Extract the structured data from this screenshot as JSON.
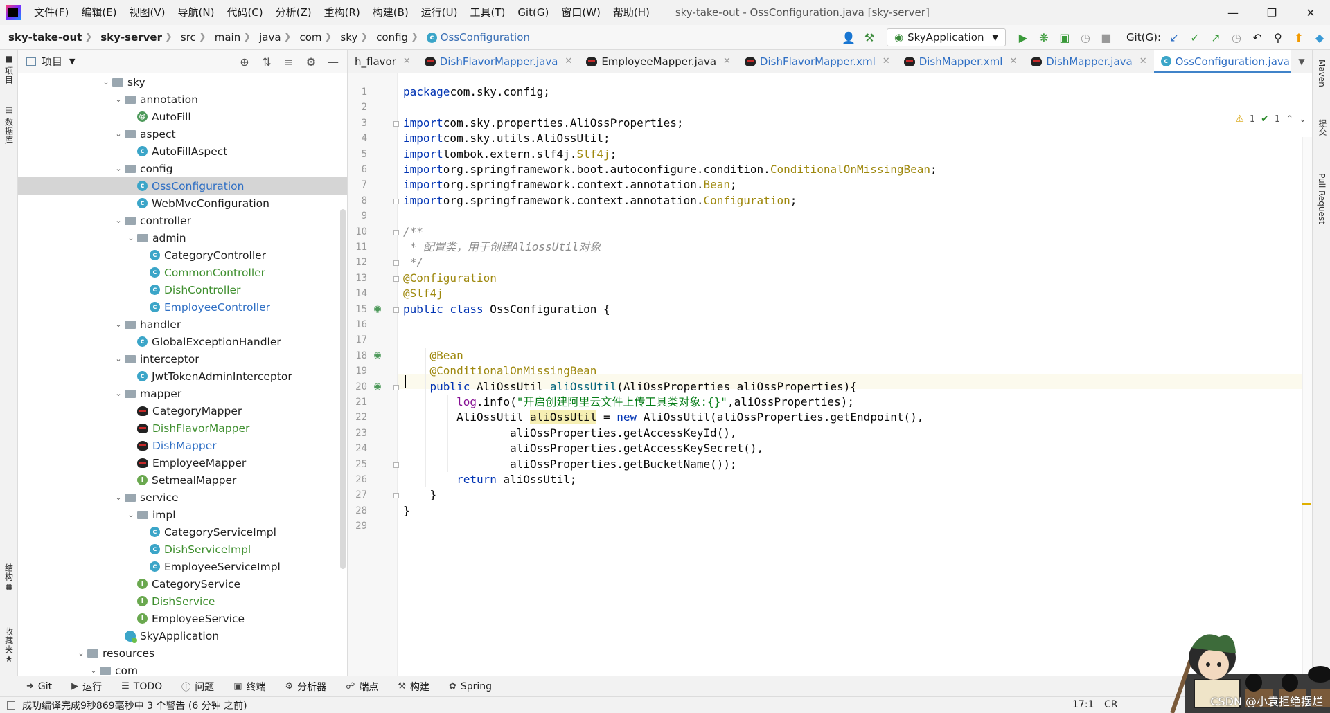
{
  "menu": [
    "文件(F)",
    "编辑(E)",
    "视图(V)",
    "导航(N)",
    "代码(C)",
    "分析(Z)",
    "重构(R)",
    "构建(B)",
    "运行(U)",
    "工具(T)",
    "Git(G)",
    "窗口(W)",
    "帮助(H)"
  ],
  "window_title": "sky-take-out - OssConfiguration.java [sky-server]",
  "breadcrumb": {
    "project": "sky-take-out",
    "module": "sky-server",
    "parts": [
      "src",
      "main",
      "java",
      "com",
      "sky",
      "config"
    ],
    "file": "OssConfiguration"
  },
  "run_config": "SkyApplication",
  "git_label": "Git(G):",
  "left_tabs": {
    "project": "项目",
    "database": "数据库",
    "structure": "结构",
    "favorites": "收藏夹"
  },
  "right_tabs": {
    "maven": "Maven",
    "commit": "提交",
    "pull": "Pull Request"
  },
  "project_panel": {
    "title": "项目"
  },
  "tree": [
    {
      "label": "sky",
      "type": "folder",
      "level": 0,
      "expanded": true
    },
    {
      "label": "annotation",
      "type": "folder",
      "level": 1,
      "expanded": true
    },
    {
      "label": "AutoFill",
      "type": "annotation",
      "level": 2
    },
    {
      "label": "aspect",
      "type": "folder",
      "level": 1,
      "expanded": true
    },
    {
      "label": "AutoFillAspect",
      "type": "class",
      "level": 2
    },
    {
      "label": "config",
      "type": "folder",
      "level": 1,
      "expanded": true
    },
    {
      "label": "OssConfiguration",
      "type": "class",
      "level": 2,
      "selected": true,
      "color": "blue"
    },
    {
      "label": "WebMvcConfiguration",
      "type": "class",
      "level": 2
    },
    {
      "label": "controller",
      "type": "folder",
      "level": 1,
      "expanded": true
    },
    {
      "label": "admin",
      "type": "folder",
      "level": 2,
      "expanded": true
    },
    {
      "label": "CategoryController",
      "type": "class",
      "level": 3
    },
    {
      "label": "CommonController",
      "type": "class",
      "level": 3,
      "color": "green"
    },
    {
      "label": "DishController",
      "type": "class",
      "level": 3,
      "color": "green"
    },
    {
      "label": "EmployeeController",
      "type": "class",
      "level": 3,
      "color": "blue"
    },
    {
      "label": "handler",
      "type": "folder",
      "level": 1,
      "expanded": true
    },
    {
      "label": "GlobalExceptionHandler",
      "type": "class",
      "level": 2
    },
    {
      "label": "interceptor",
      "type": "folder",
      "level": 1,
      "expanded": true
    },
    {
      "label": "JwtTokenAdminInterceptor",
      "type": "class",
      "level": 2
    },
    {
      "label": "mapper",
      "type": "folder",
      "level": 1,
      "expanded": true
    },
    {
      "label": "CategoryMapper",
      "type": "mapper",
      "level": 2
    },
    {
      "label": "DishFlavorMapper",
      "type": "mapper",
      "level": 2,
      "color": "green"
    },
    {
      "label": "DishMapper",
      "type": "mapper",
      "level": 2,
      "color": "blue"
    },
    {
      "label": "EmployeeMapper",
      "type": "mapper",
      "level": 2
    },
    {
      "label": "SetmealMapper",
      "type": "interface",
      "level": 2
    },
    {
      "label": "service",
      "type": "folder",
      "level": 1,
      "expanded": true
    },
    {
      "label": "impl",
      "type": "folder",
      "level": 2,
      "expanded": true
    },
    {
      "label": "CategoryServiceImpl",
      "type": "class",
      "level": 3
    },
    {
      "label": "DishServiceImpl",
      "type": "class",
      "level": 3,
      "color": "green"
    },
    {
      "label": "EmployeeServiceImpl",
      "type": "class",
      "level": 3
    },
    {
      "label": "CategoryService",
      "type": "interface",
      "level": 2
    },
    {
      "label": "DishService",
      "type": "interface",
      "level": 2,
      "color": "green"
    },
    {
      "label": "EmployeeService",
      "type": "interface",
      "level": 2
    },
    {
      "label": "SkyApplication",
      "type": "app",
      "level": 1
    },
    {
      "label": "resources",
      "type": "folder",
      "level": -2,
      "expanded": true
    },
    {
      "label": "com",
      "type": "folder",
      "level": -1,
      "expanded": true
    }
  ],
  "tabs": [
    {
      "label": "h_flavor",
      "kind": "plain",
      "partial": true
    },
    {
      "label": "DishFlavorMapper.java",
      "kind": "mapper"
    },
    {
      "label": "EmployeeMapper.java",
      "kind": "mapper",
      "plain": true
    },
    {
      "label": "DishFlavorMapper.xml",
      "kind": "mapper"
    },
    {
      "label": "DishMapper.xml",
      "kind": "mapper"
    },
    {
      "label": "DishMapper.java",
      "kind": "mapper"
    },
    {
      "label": "OssConfiguration.java",
      "kind": "class",
      "active": true
    }
  ],
  "inspections": {
    "warnings": "1",
    "ok": "1"
  },
  "code_lines": [
    [
      [
        "kw",
        "package"
      ],
      [
        "",
        "com.sky.config;"
      ]
    ],
    [],
    [
      [
        "kw",
        "import"
      ],
      [
        "",
        "com.sky.properties.AliOssProperties;"
      ]
    ],
    [
      [
        "kw",
        "import"
      ],
      [
        "",
        "com.sky.utils.AliOssUtil;"
      ]
    ],
    [
      [
        "kw",
        "import"
      ],
      [
        "",
        "lombok.extern.slf4j."
      ],
      [
        "ann",
        "Slf4j"
      ],
      [
        "",
        ";"
      ]
    ],
    [
      [
        "kw",
        "import"
      ],
      [
        "",
        "org.springframework.boot.autoconfigure.condition."
      ],
      [
        "ann",
        "ConditionalOnMissingBean"
      ],
      [
        "",
        ";"
      ]
    ],
    [
      [
        "kw",
        "import"
      ],
      [
        "",
        "org.springframework.context.annotation."
      ],
      [
        "ann",
        "Bean"
      ],
      [
        "",
        ";"
      ]
    ],
    [
      [
        "kw",
        "import"
      ],
      [
        "",
        "org.springframework.context.annotation."
      ],
      [
        "ann",
        "Configuration"
      ],
      [
        "",
        ";"
      ]
    ],
    [],
    [
      [
        "cmt",
        "/**"
      ]
    ],
    [
      [
        "cmt",
        " * 配置类，用于创建AliossUtil对象"
      ]
    ],
    [
      [
        "cmt",
        " */"
      ]
    ],
    [
      [
        "ann",
        "@Configuration"
      ]
    ],
    [
      [
        "ann",
        "@Slf4j"
      ]
    ],
    [
      [
        "kw",
        "public class "
      ],
      [
        "",
        "OssConfiguration {"
      ]
    ],
    [],
    [],
    [
      [
        "",
        "    "
      ],
      [
        "ann",
        "@Bean"
      ]
    ],
    [
      [
        "",
        "    "
      ],
      [
        "ann",
        "@ConditionalOnMissingBean"
      ]
    ],
    [
      [
        "",
        "    "
      ],
      [
        "kw",
        "public "
      ],
      [
        "",
        "AliOssUtil "
      ],
      [
        "fn",
        "aliOssUtil"
      ],
      [
        "",
        "(AliOssProperties aliOssProperties){"
      ]
    ],
    [
      [
        "",
        "        "
      ],
      [
        "fld",
        "log"
      ],
      [
        "",
        ".info("
      ],
      [
        "str",
        "\"开启创建阿里云文件上传工具类对象:{}\""
      ],
      [
        "",
        ",aliOssProperties);"
      ]
    ],
    [
      [
        "",
        "        AliOssUtil "
      ],
      [
        "hl",
        "aliOssUtil"
      ],
      [
        "",
        " = "
      ],
      [
        "kw",
        "new "
      ],
      [
        "",
        "AliOssUtil(aliOssProperties.getEndpoint(),"
      ]
    ],
    [
      [
        "",
        "                aliOssProperties.getAccessKeyId(),"
      ]
    ],
    [
      [
        "",
        "                aliOssProperties.getAccessKeySecret(),"
      ]
    ],
    [
      [
        "",
        "                aliOssProperties.getBucketName());"
      ]
    ],
    [
      [
        "",
        "        "
      ],
      [
        "kw",
        "return "
      ],
      [
        "",
        "aliOssUtil;"
      ]
    ],
    [
      [
        "",
        "    }"
      ]
    ],
    [
      [
        "",
        "}"
      ]
    ],
    []
  ],
  "bottom_tools": [
    {
      "icon": "git-icon",
      "label": "Git"
    },
    {
      "icon": "run-icon",
      "label": "运行"
    },
    {
      "icon": "todo-icon",
      "label": "TODO"
    },
    {
      "icon": "problems-icon",
      "label": "问题"
    },
    {
      "icon": "terminal-icon",
      "label": "终端"
    },
    {
      "icon": "profiler-icon",
      "label": "分析器"
    },
    {
      "icon": "endpoints-icon",
      "label": "端点"
    },
    {
      "icon": "build-icon",
      "label": "构建"
    },
    {
      "icon": "spring-icon",
      "label": "Spring"
    }
  ],
  "status": {
    "message": "成功编译完成9秒869毫秒中 3 个警告 (6 分钟 之前)",
    "position": "17:1",
    "line_sep": "CR"
  },
  "watermark": "CSDN @小袁拒绝摆烂"
}
